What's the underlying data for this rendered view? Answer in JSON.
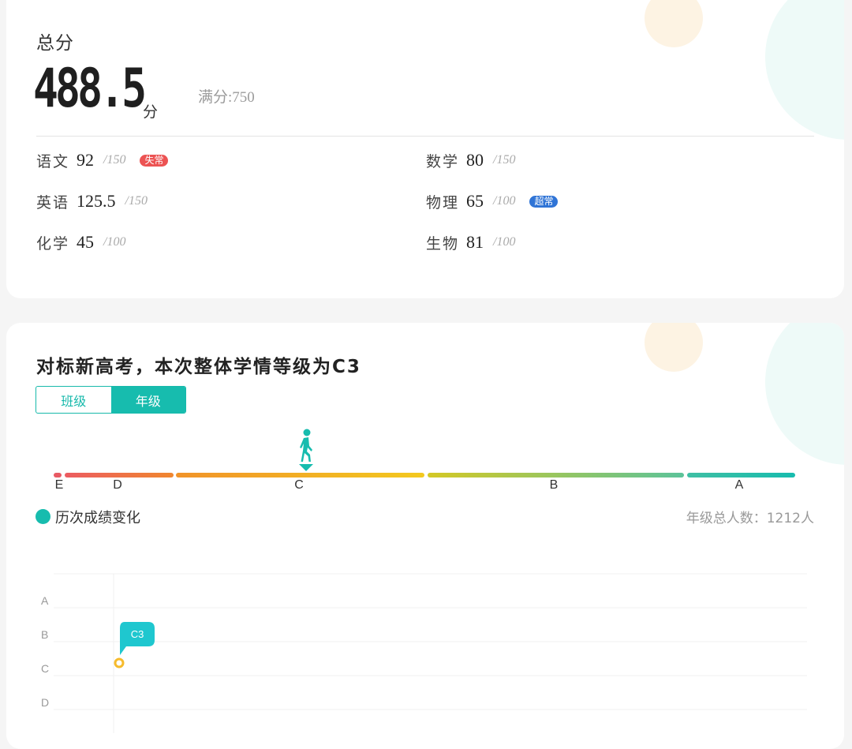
{
  "score_card": {
    "title": "总分",
    "total": "488.5",
    "unit": "分",
    "full_score": "满分:750",
    "subjects": [
      {
        "name": "语文",
        "score": "92",
        "full": "/150",
        "badge": "失常",
        "badge_color": "#ec5353"
      },
      {
        "name": "数学",
        "score": "80",
        "full": "/150",
        "badge": "",
        "badge_color": ""
      },
      {
        "name": "英语",
        "score": "125.5",
        "full": "/150",
        "badge": "",
        "badge_color": ""
      },
      {
        "name": "物理",
        "score": "65",
        "full": "/100",
        "badge": "超常",
        "badge_color": "#2f74d6"
      },
      {
        "name": "化学",
        "score": "45",
        "full": "/100",
        "badge": "",
        "badge_color": ""
      },
      {
        "name": "生物",
        "score": "81",
        "full": "/100",
        "badge": "",
        "badge_color": ""
      }
    ]
  },
  "level_card": {
    "title": "对标新高考，本次整体学情等级为C3",
    "tabs": [
      {
        "label": "班级",
        "active": false
      },
      {
        "label": "年级",
        "active": true
      }
    ],
    "grade_scale": [
      "E",
      "D",
      "C",
      "B",
      "A"
    ],
    "current_level": "C3",
    "legend_label": "历次成绩变化",
    "grade_count_label": "年级总人数：",
    "grade_count_value": "1212人",
    "history_axis": [
      "A",
      "B",
      "C",
      "D"
    ],
    "history_point_label": "C3"
  },
  "colors": {
    "accent": "#17bcae",
    "bad": "#ec5353",
    "good": "#2f74d6"
  }
}
